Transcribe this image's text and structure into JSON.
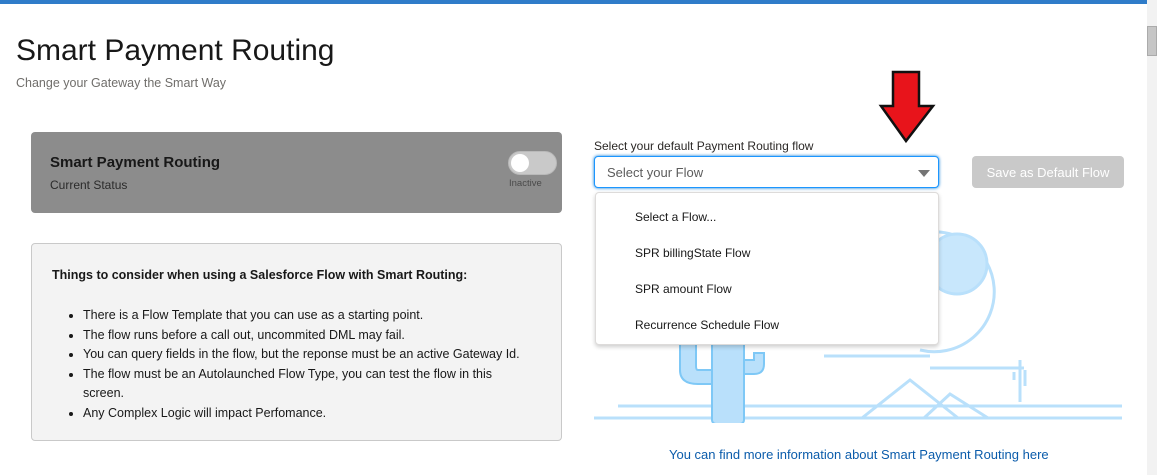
{
  "app": {
    "title": "Smart Payment Routing",
    "subtitle": "Change your Gateway the Smart Way"
  },
  "status_card": {
    "title": "Smart Payment Routing",
    "subtitle": "Current Status",
    "toggle_label": "Inactive",
    "toggle_on": false
  },
  "info": {
    "heading": "Things to consider when using a Salesforce Flow with Smart Routing:",
    "items": [
      "There is a Flow Template that you can use as a starting point.",
      "The flow runs before a call out, uncommited DML may fail.",
      "You can query fields in the flow, but the reponse must be an active Gateway Id.",
      "The flow must be an Autolaunched Flow Type, you can test the flow in this screen.",
      "Any Complex Logic will impact Perfomance."
    ]
  },
  "flow_select": {
    "label": "Select your default Payment Routing flow",
    "placeholder": "Select your Flow",
    "options": [
      "Select a Flow...",
      "SPR billingState Flow",
      "SPR amount Flow",
      "Recurrence Schedule Flow"
    ]
  },
  "save_button": {
    "label": "Save as Default Flow",
    "enabled": false
  },
  "more_info_link": "You can find more information about Smart Payment Routing here",
  "colors": {
    "accent": "#0176d3",
    "link": "#0b5cab",
    "arrow": "#e8141b",
    "status_card_bg": "#8c8c8c",
    "illustration": "#b9e0fb"
  }
}
